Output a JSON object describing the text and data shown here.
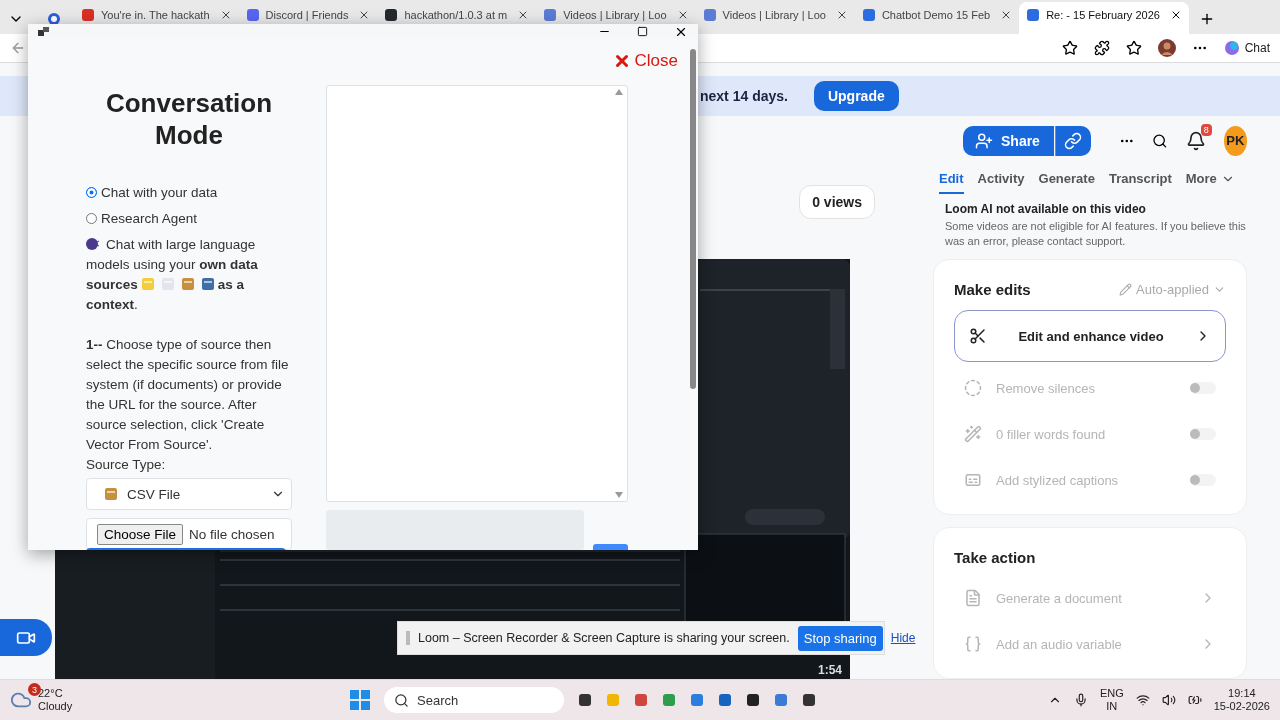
{
  "browser": {
    "tabs": [
      {
        "title": "You're in. The hackath",
        "selected": false
      },
      {
        "title": "Discord | Friends",
        "selected": false
      },
      {
        "title": "hackathon/1.0.3 at m",
        "selected": false
      },
      {
        "title": "Videos | Library | Loo",
        "selected": false
      },
      {
        "title": "Videos | Library | Loo",
        "selected": false
      },
      {
        "title": "Chatbot Demo 15 Feb",
        "selected": false
      },
      {
        "title": "Re: - 15 February 2026",
        "selected": true
      }
    ],
    "chat_label": "Chat"
  },
  "banner": {
    "text": "next 14 days.",
    "button": "Upgrade"
  },
  "header": {
    "share": "Share",
    "notifications_badge": "8",
    "avatar": "PK"
  },
  "views": "0 views",
  "video": {
    "duration": "1:54"
  },
  "panel": {
    "tabs": [
      {
        "label": "Edit",
        "selected": true
      },
      {
        "label": "Activity",
        "selected": false
      },
      {
        "label": "Generate",
        "selected": false
      },
      {
        "label": "Transcript",
        "selected": false
      },
      {
        "label": "More",
        "selected": false
      }
    ],
    "notice_title": "Loom AI not available on this video",
    "notice_text": "Some videos are not eligible for AI features. If you believe this was an error, please contact support.",
    "make_edits": {
      "title": "Make edits",
      "mode": "Auto-applied",
      "primary": "Edit and enhance video",
      "options": [
        {
          "kind": "silence",
          "label": "Remove silences",
          "on": false,
          "disabled": true
        },
        {
          "kind": "filler",
          "label": "0 filler words found",
          "on": false,
          "disabled": true
        },
        {
          "kind": "captions",
          "label": "Add stylized captions",
          "on": false,
          "disabled": true
        }
      ]
    },
    "take_action": {
      "title": "Take action",
      "items": [
        {
          "kind": "document",
          "label": "Generate a document",
          "disabled": true
        },
        {
          "kind": "variable",
          "label": "Add an audio variable",
          "disabled": true
        }
      ]
    }
  },
  "share_bar": {
    "message": "Loom – Screen Recorder & Screen Capture is sharing your screen.",
    "stop": "Stop sharing",
    "hide": "Hide"
  },
  "dialog": {
    "close": "Close",
    "heading": "Conversation Mode",
    "modes": [
      {
        "label": "Chat with your data",
        "selected": true
      },
      {
        "label": "Research Agent",
        "selected": false
      }
    ],
    "intro_before": "Chat with large language models using your **own data sources**",
    "intro_after": "**as a context**.",
    "step": "**1--** Choose type of source then select the specific source from file system (if documents) or provide the URL for the source. After source selection, click 'Create Vector From Source'.",
    "source_label": "Source Type:",
    "source_value": "CSV File",
    "file_button": "Choose File",
    "file_status": "No file chosen"
  },
  "taskbar": {
    "weather_badge": "3",
    "temperature": "22°C",
    "condition": "Cloudy",
    "search": "Search",
    "language": "ENG",
    "region": "IN",
    "time": "19:14",
    "date": "15-02-2026"
  }
}
